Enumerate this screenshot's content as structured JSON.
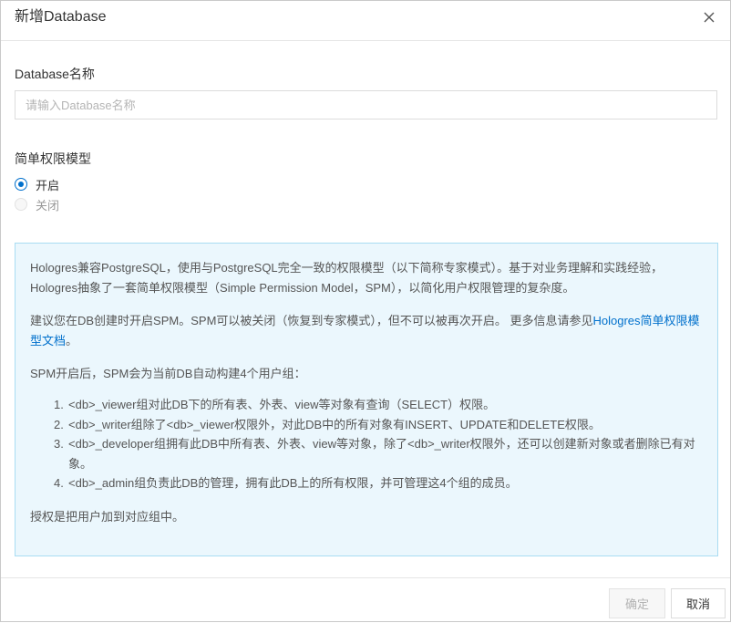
{
  "dialog": {
    "title": "新增Database",
    "close_icon": "close-icon"
  },
  "name_field": {
    "label": "Database名称",
    "value": "",
    "placeholder": "请输入Database名称"
  },
  "permission_model": {
    "label": "简单权限模型",
    "options": [
      {
        "label": "开启",
        "selected": true,
        "disabled": false
      },
      {
        "label": "关闭",
        "selected": false,
        "disabled": true
      }
    ]
  },
  "info": {
    "paragraph1": "Hologres兼容PostgreSQL，使用与PostgreSQL完全一致的权限模型（以下简称专家模式）。基于对业务理解和实践经验，Hologres抽象了一套简单权限模型（Simple Permission Model，SPM），以简化用户权限管理的复杂度。",
    "paragraph2_text": "建议您在DB创建时开启SPM。SPM可以被关闭（恢复到专家模式），但不可以被再次开启。 更多信息请参见",
    "paragraph2_link": "Hologres简单权限模型文档",
    "paragraph2_end": "。",
    "paragraph3": "SPM开启后，SPM会为当前DB自动构建4个用户组：",
    "groups": [
      {
        "num": "1.",
        "text": "<db>_viewer组对此DB下的所有表、外表、view等对象有查询（SELECT）权限。"
      },
      {
        "num": "2.",
        "text": "<db>_writer组除了<db>_viewer权限外，对此DB中的所有对象有INSERT、UPDATE和DELETE权限。"
      },
      {
        "num": "3.",
        "text": "<db>_developer组拥有此DB中所有表、外表、view等对象，除了<db>_writer权限外，还可以创建新对象或者删除已有对象。"
      },
      {
        "num": "4.",
        "text": "<db>_admin组负责此DB的管理，拥有此DB上的所有权限，并可管理这4个组的成员。"
      }
    ],
    "paragraph4": "授权是把用户加到对应组中。"
  },
  "footer": {
    "ok_label": "确定",
    "cancel_label": "取消"
  },
  "colors": {
    "accent": "#0070cc",
    "info_bg": "#ebf7fd",
    "info_border": "#a9dcf2"
  }
}
